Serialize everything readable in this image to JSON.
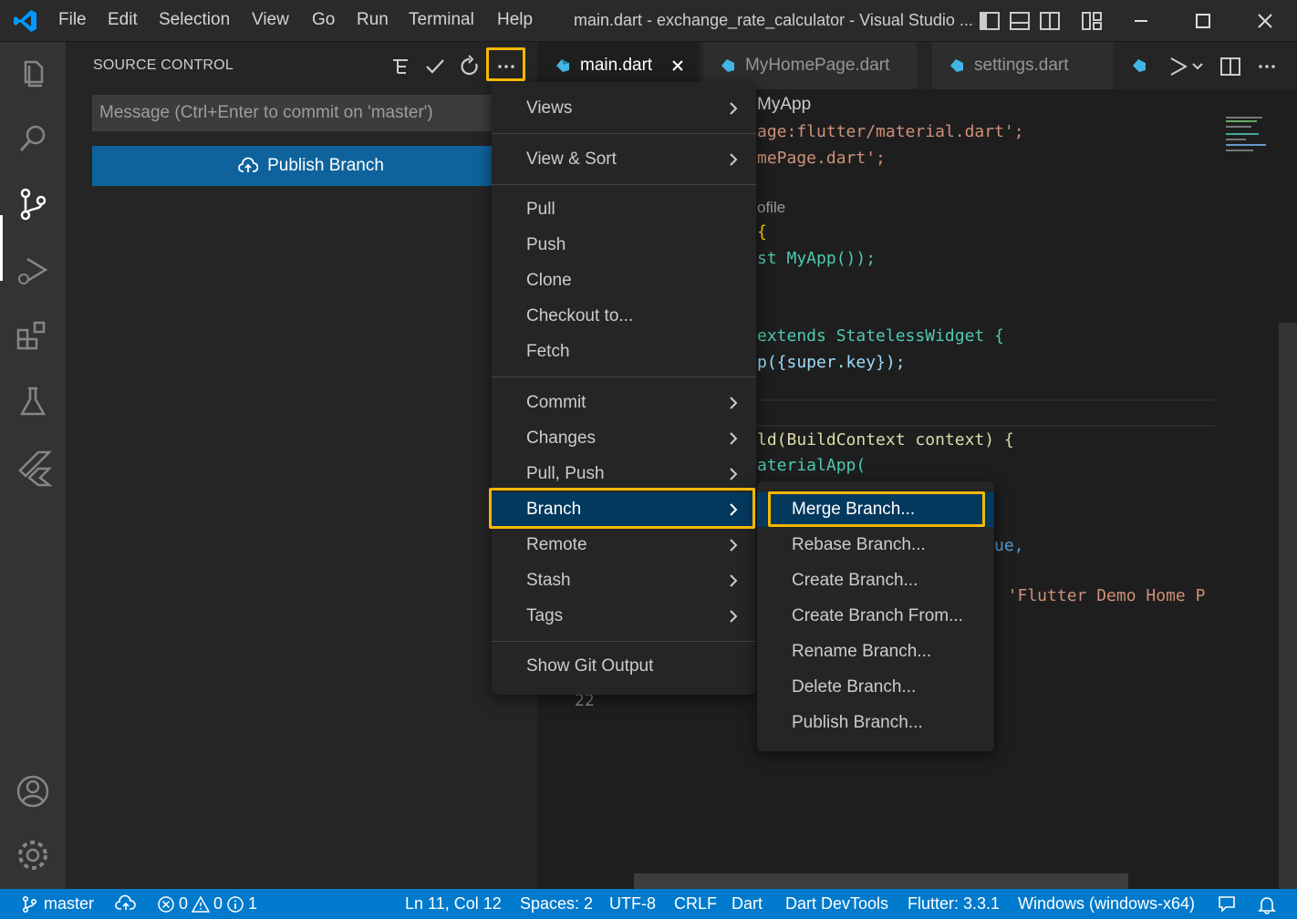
{
  "titlebar": {
    "menus": [
      "File",
      "Edit",
      "Selection",
      "View",
      "Go",
      "Run",
      "Terminal",
      "Help"
    ],
    "window_title": "main.dart - exchange_rate_calculator - Visual Studio ..."
  },
  "sidebar": {
    "title": "SOURCE CONTROL",
    "message_placeholder": "Message (Ctrl+Enter to commit on 'master')",
    "publish_label": "Publish Branch"
  },
  "tabs": [
    {
      "label": "main.dart",
      "active": true
    },
    {
      "label": "MyHomePage.dart",
      "active": false
    },
    {
      "label": "settings.dart",
      "active": false
    }
  ],
  "code": {
    "lines": [
      "MyApp",
      "age:flutter/material.dart';",
      "mePage.dart';",
      "ofile",
      "{",
      "st MyApp());",
      "extends StatelessWidget {",
      "p({super.key});",
      "ld(BuildContext context) {",
      "aterialApp(",
      "ue,",
      ": 'Flutter Demo Home P"
    ],
    "line_number": "22"
  },
  "more_menu": {
    "items": [
      {
        "label": "Views",
        "submenu": true
      },
      {
        "label": "View & Sort",
        "submenu": true
      },
      {
        "label": "Pull",
        "submenu": false
      },
      {
        "label": "Push",
        "submenu": false
      },
      {
        "label": "Clone",
        "submenu": false
      },
      {
        "label": "Checkout to...",
        "submenu": false
      },
      {
        "label": "Fetch",
        "submenu": false
      },
      {
        "label": "Commit",
        "submenu": true
      },
      {
        "label": "Changes",
        "submenu": true
      },
      {
        "label": "Pull, Push",
        "submenu": true
      },
      {
        "label": "Branch",
        "submenu": true
      },
      {
        "label": "Remote",
        "submenu": true
      },
      {
        "label": "Stash",
        "submenu": true
      },
      {
        "label": "Tags",
        "submenu": true
      },
      {
        "label": "Show Git Output",
        "submenu": false
      }
    ]
  },
  "branch_menu": {
    "items": [
      "Merge Branch...",
      "Rebase Branch...",
      "Create Branch...",
      "Create Branch From...",
      "Rename Branch...",
      "Delete Branch...",
      "Publish Branch..."
    ]
  },
  "statusbar": {
    "branch": "master",
    "errors": "0",
    "warnings": "0",
    "info": "1",
    "position": "Ln 11, Col 12",
    "spaces": "Spaces: 2",
    "encoding": "UTF-8",
    "eol": "CRLF",
    "language": "Dart",
    "devtools": "Dart DevTools",
    "flutter": "Flutter: 3.3.1",
    "device": "Windows (windows-x64)"
  },
  "colors": {
    "accent": "#007acc",
    "highlight": "#f5b800",
    "button": "#0e639c",
    "selected_menu": "#04395e"
  }
}
